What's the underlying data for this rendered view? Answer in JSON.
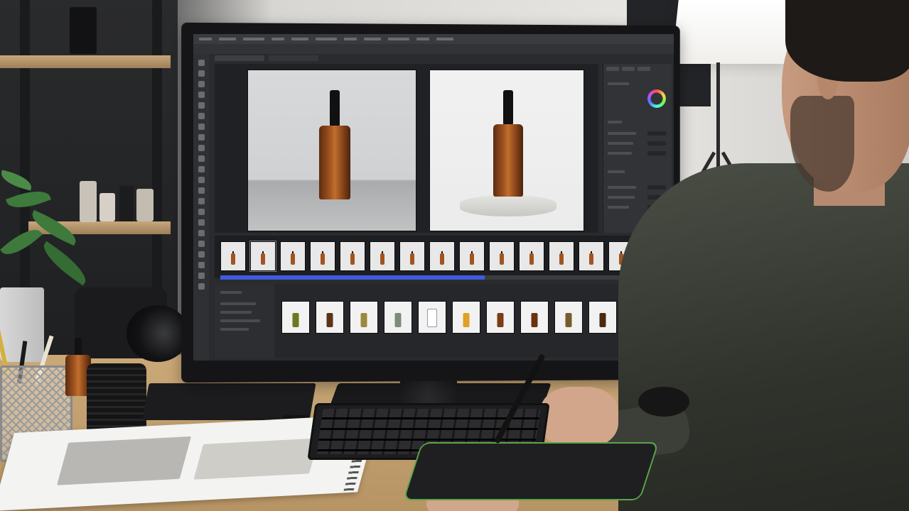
{
  "scene": {
    "description_tags": [
      "studio",
      "monitor",
      "photo-editor",
      "amber-bottles",
      "person",
      "desk"
    ]
  },
  "editor": {
    "menu": [
      "",
      "",
      "",
      "",
      "",
      "",
      "",
      "",
      "",
      "",
      ""
    ],
    "accent": "#3f5be0",
    "timeline_progress": 0.6,
    "filmstrip_count": 16,
    "product_row": [
      {
        "color": "#6b7a1e",
        "type": "bottle"
      },
      {
        "color": "#5a3416",
        "type": "bottle"
      },
      {
        "color": "#9c8a3b",
        "type": "bottle"
      },
      {
        "color": "#7a8d7a",
        "type": "bottle"
      },
      {
        "color": "#ffffff",
        "type": "tube"
      },
      {
        "color": "#e0a027",
        "type": "bottle"
      },
      {
        "color": "#7a3d16",
        "type": "bottle"
      },
      {
        "color": "#6a3212",
        "type": "bottle"
      },
      {
        "color": "#7a5a2a",
        "type": "bottle"
      },
      {
        "color": "#4a2a12",
        "type": "bottle"
      },
      {
        "color": "#5c8a2a",
        "type": "bottle"
      },
      {
        "color": "#c49a6c",
        "type": "tube"
      },
      {
        "color": "#7a3d16",
        "type": "bottle"
      }
    ]
  },
  "colors": {
    "amber": "#a2541f",
    "desk": "#caa877",
    "shirt": "#3b3f37"
  }
}
